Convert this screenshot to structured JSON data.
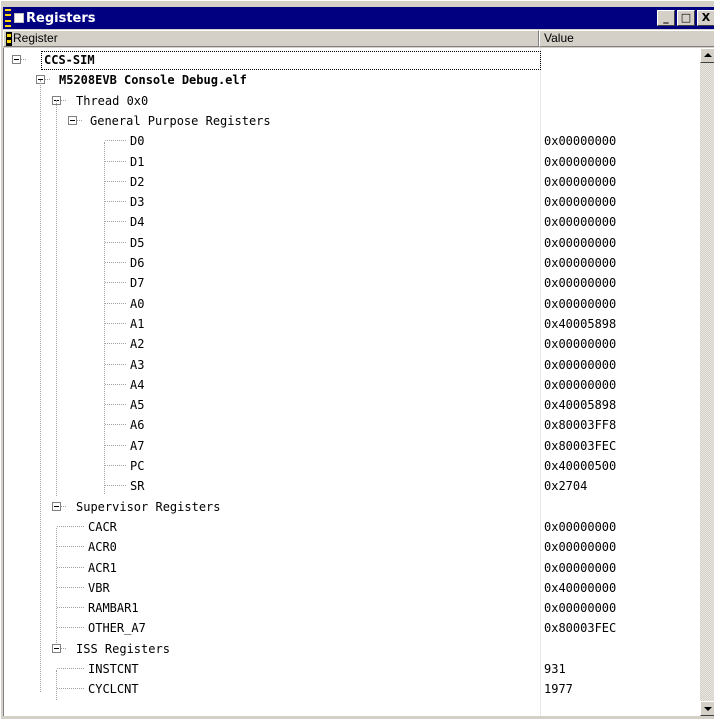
{
  "window": {
    "title": "Registers",
    "buttons": [
      "_",
      "□",
      "X"
    ]
  },
  "header": {
    "register_label": "Register",
    "value_label": "Value"
  },
  "tree": [
    {
      "label": "CCS-SIM",
      "value": "",
      "level": 0,
      "bold": true,
      "expander": true,
      "selected": true
    },
    {
      "label": "M5208EVB Console Debug.elf",
      "value": "",
      "level": 1,
      "bold": true,
      "expander": true
    },
    {
      "label": "Thread 0x0",
      "value": "",
      "level": 2,
      "expander": true
    },
    {
      "label": "General Purpose Registers",
      "value": "",
      "level": 3,
      "expander": true
    },
    {
      "label": "D0",
      "value": "0x00000000",
      "level": 4
    },
    {
      "label": "D1",
      "value": "0x00000000",
      "level": 4
    },
    {
      "label": "D2",
      "value": "0x00000000",
      "level": 4
    },
    {
      "label": "D3",
      "value": "0x00000000",
      "level": 4
    },
    {
      "label": "D4",
      "value": "0x00000000",
      "level": 4
    },
    {
      "label": "D5",
      "value": "0x00000000",
      "level": 4
    },
    {
      "label": "D6",
      "value": "0x00000000",
      "level": 4
    },
    {
      "label": "D7",
      "value": "0x00000000",
      "level": 4
    },
    {
      "label": "A0",
      "value": "0x00000000",
      "level": 4
    },
    {
      "label": "A1",
      "value": "0x40005898",
      "level": 4
    },
    {
      "label": "A2",
      "value": "0x00000000",
      "level": 4
    },
    {
      "label": "A3",
      "value": "0x00000000",
      "level": 4
    },
    {
      "label": "A4",
      "value": "0x00000000",
      "level": 4
    },
    {
      "label": "A5",
      "value": "0x40005898",
      "level": 4
    },
    {
      "label": "A6",
      "value": "0x80003FF8",
      "level": 4
    },
    {
      "label": "A7",
      "value": "0x80003FEC",
      "level": 4
    },
    {
      "label": "PC",
      "value": "0x40000500",
      "level": 4
    },
    {
      "label": "SR",
      "value": "0x2704",
      "level": 4
    },
    {
      "label": "Supervisor Registers",
      "value": "",
      "level": 2,
      "expander": true
    },
    {
      "label": "CACR",
      "value": "0x00000000",
      "level": 3
    },
    {
      "label": "ACR0",
      "value": "0x00000000",
      "level": 3
    },
    {
      "label": "ACR1",
      "value": "0x00000000",
      "level": 3
    },
    {
      "label": "VBR",
      "value": "0x40000000",
      "level": 3
    },
    {
      "label": "RAMBAR1",
      "value": "0x00000000",
      "level": 3
    },
    {
      "label": "OTHER_A7",
      "value": "0x80003FEC",
      "level": 3
    },
    {
      "label": "ISS Registers",
      "value": "",
      "level": 2,
      "expander": true
    },
    {
      "label": "INSTCNT",
      "value": "931",
      "level": 3
    },
    {
      "label": "CYCLCNT",
      "value": "1977",
      "level": 3
    }
  ]
}
